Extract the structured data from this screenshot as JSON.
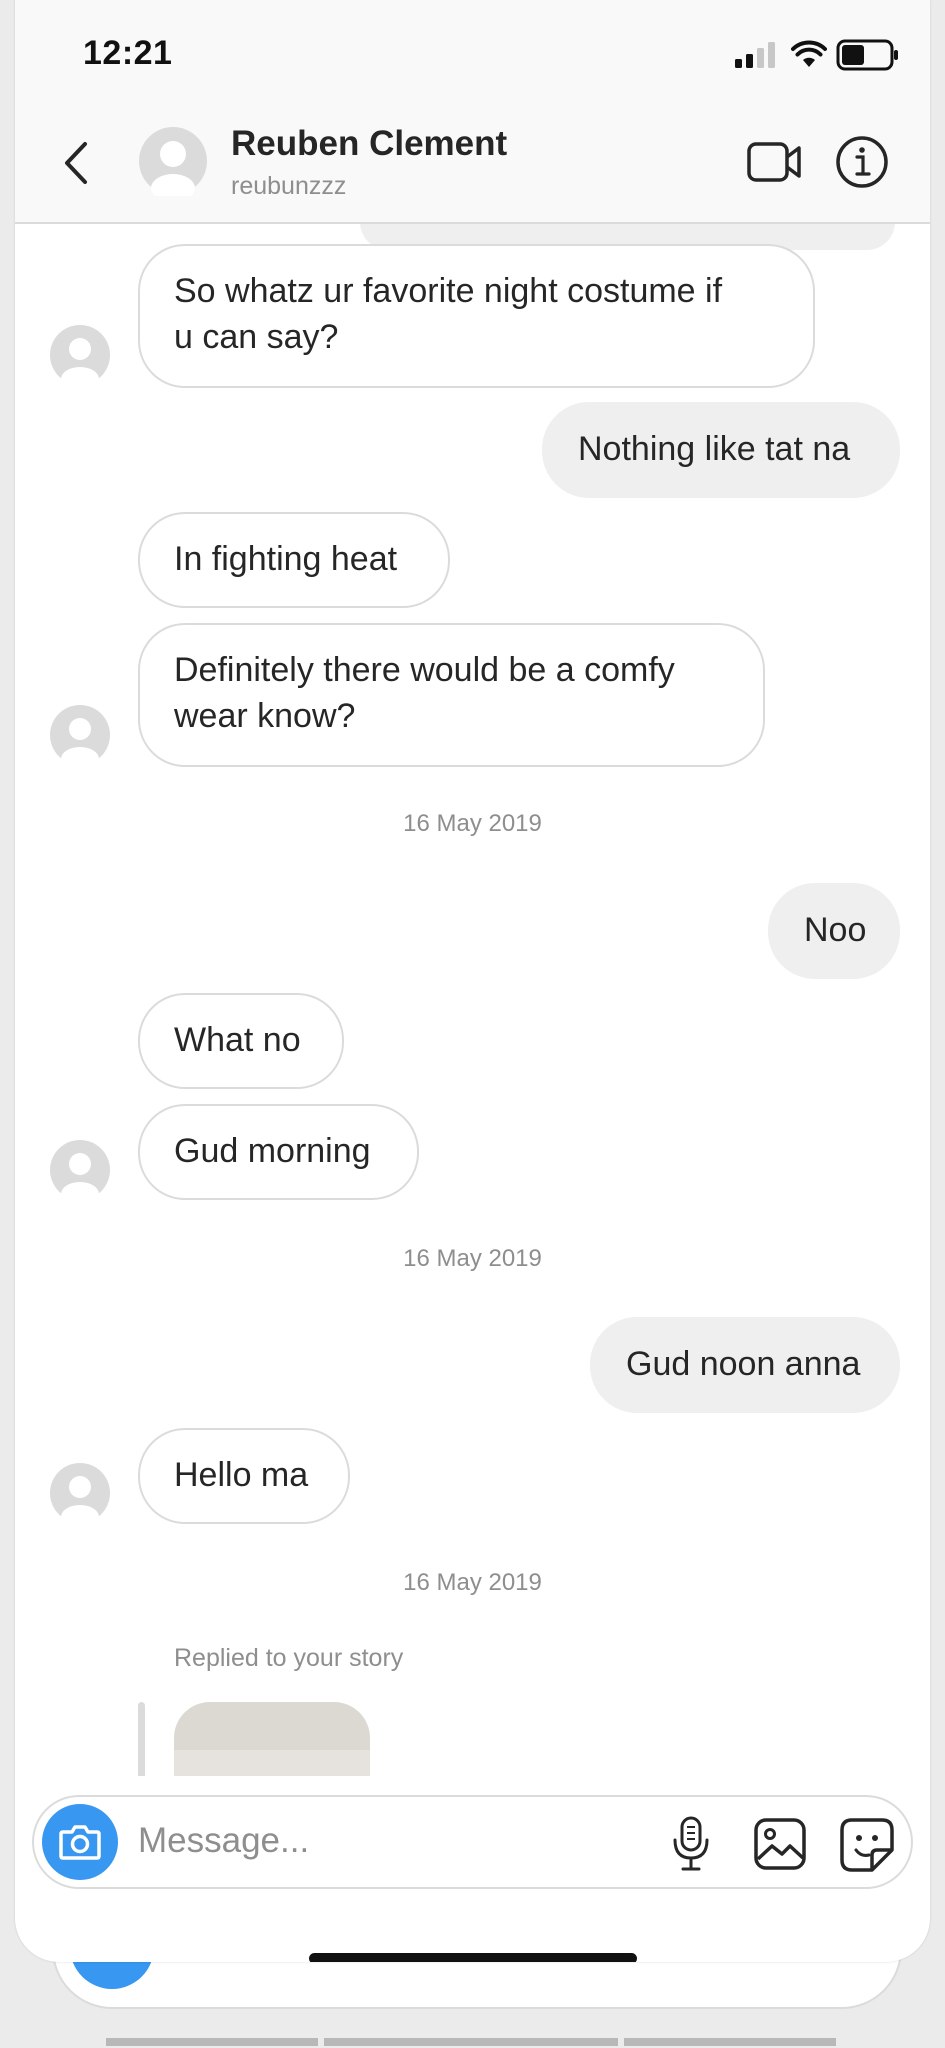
{
  "status_bar": {
    "time": "12:21"
  },
  "header": {
    "contact_name": "Reuben Clement",
    "username": "reubunzzz"
  },
  "thread": {
    "messages": [
      {
        "direction": "incoming",
        "text": "So whatz ur favorite  night costume if\nu can say?"
      },
      {
        "direction": "outgoing",
        "text": "Nothing like tat na"
      },
      {
        "direction": "incoming",
        "text": "In fighting heat"
      },
      {
        "direction": "incoming",
        "text": "Definitely  there would be a comfy\nwear know?"
      },
      {
        "direction": "outgoing",
        "text": "Noo"
      },
      {
        "direction": "incoming",
        "text": "What no"
      },
      {
        "direction": "incoming",
        "text": "Gud morning"
      },
      {
        "direction": "outgoing",
        "text": "Gud noon anna"
      },
      {
        "direction": "incoming",
        "text": "Hello ma"
      }
    ],
    "date_separators": [
      "16 May 2019",
      "16 May 2019",
      "16 May 2019"
    ],
    "story_reply_label": "Replied to your story"
  },
  "composer": {
    "placeholder": "Message..."
  },
  "icons": {
    "back": "chevron-left-icon",
    "video_call": "video-camera-icon",
    "info": "info-icon",
    "camera": "camera-icon",
    "mic": "microphone-icon",
    "gallery": "image-icon",
    "sticker": "sticker-icon"
  },
  "colors": {
    "accent_blue": "#3897f0",
    "outgoing_bubble": "#efefef",
    "incoming_border": "#dbdbdb",
    "secondary_text": "#8e8e8e"
  }
}
